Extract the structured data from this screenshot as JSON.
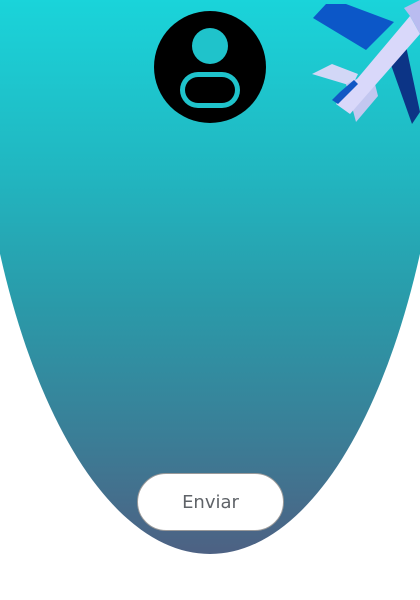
{
  "form": {
    "submit_label": "Enviar"
  },
  "icons": {
    "avatar": "user-circle-icon",
    "plane": "airplane-icon"
  },
  "colors": {
    "gradient_top": "#16d6dc",
    "gradient_bottom": "#4d6183",
    "avatar": "#000000",
    "button_background": "#ffffff",
    "button_text": "#5f6368"
  }
}
